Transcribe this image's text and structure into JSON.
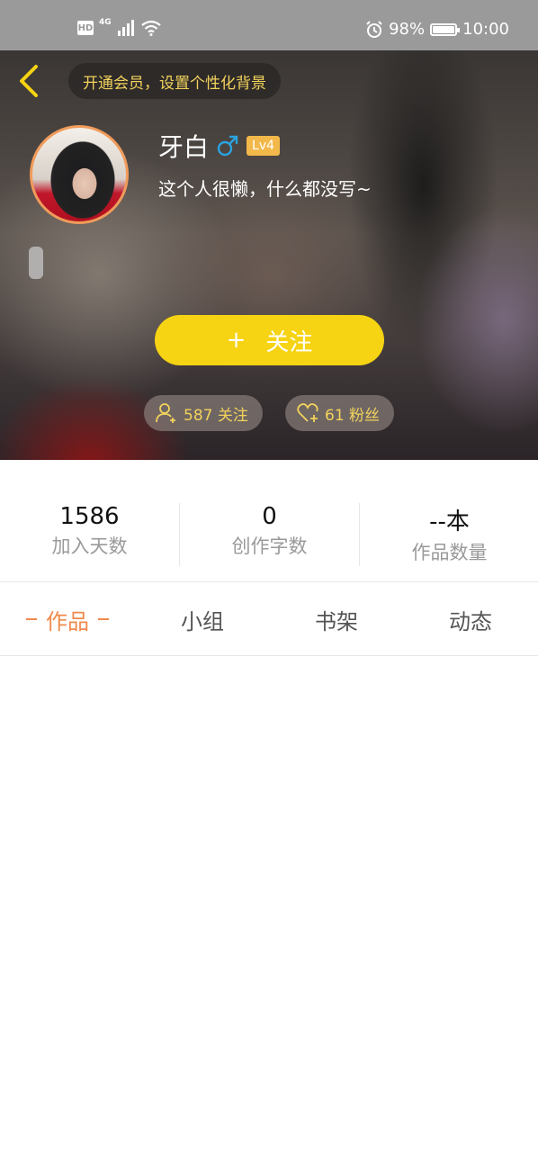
{
  "status_bar": {
    "hd": "HD",
    "network": "4G",
    "battery_text": "98%",
    "battery_level": 0.98,
    "time": "10:00"
  },
  "header": {
    "vip_prompt": "开通会员，设置个性化背景"
  },
  "profile": {
    "name": "牙白",
    "gender_icon": "male-icon",
    "level": "Lv4",
    "bio": "这个人很懒，什么都没写~",
    "follow_button": "关注",
    "follow_plus": "+",
    "following_text": "587 关注",
    "fans_text": "61 粉丝"
  },
  "stats": [
    {
      "value": "1586",
      "label": "加入天数"
    },
    {
      "value": "0",
      "label": "创作字数"
    },
    {
      "value": "--本",
      "label": "作品数量"
    }
  ],
  "tabs": [
    {
      "label": "作品",
      "active": true
    },
    {
      "label": "小组",
      "active": false
    },
    {
      "label": "书架",
      "active": false
    },
    {
      "label": "动态",
      "active": false
    }
  ],
  "colors": {
    "accent_yellow": "#f6d313",
    "accent_orange": "#f08a4b",
    "gender_blue": "#2ba3e0",
    "level_badge": "#f2b84a"
  }
}
